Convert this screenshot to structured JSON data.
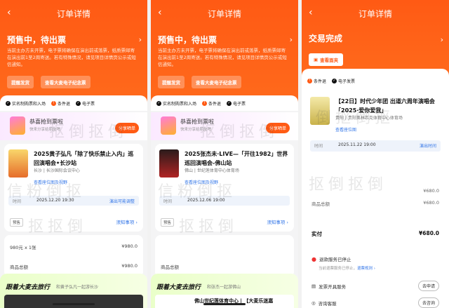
{
  "nav": {
    "title": "订单详情",
    "back": "‹"
  },
  "colors": {
    "brand": "#ff5a14",
    "link": "#3477e8"
  },
  "panel1": {
    "status": "预售中，待出票",
    "notice": "当前主办方未开票，电子票将确保在演出前或落票，纸质票邮寄在演出前1至2周寄送。若有特殊情况，请见项目详情页公示或短信通知。",
    "btn_remind": "提醒发货",
    "btn_ticket": "查看大麦电子纪念票",
    "tags": [
      "实名制购票和入场",
      "条件退",
      "电子票"
    ],
    "promo_title": "恭喜抢到票啦",
    "promo_sub": "快来分享给朋友吧",
    "promo_btn": "分享晒单",
    "show_title": "2025黄子弘凡「除了快乐禁止入内」巡回演唱会•长沙站",
    "venue": "长沙 | 长沙国际会议中心",
    "map_link": "查看座位图及视野",
    "time_label": "时间",
    "time_value": "2025.12.20 19:30",
    "time_right": "演出可能调整",
    "presale": "预售",
    "notes": "须知事项 ›",
    "price_line": "980元 x 1张",
    "price_amount": "¥980.0",
    "total_label": "商品总额",
    "total_amount": "¥980.0",
    "banner_title": "跟着大麦去旅行",
    "banner_sub": "和黄子弘凡一起游长沙"
  },
  "panel2": {
    "status": "预售中，待出票",
    "notice": "当前主办方未开票，电子票将确保在演出前或落票，纸质票邮寄在演出前1至2周寄送。若有特殊情况，请见项目详情页公示或短信通知。",
    "btn_remind": "提醒发货",
    "btn_ticket": "查看大麦电子纪念票",
    "tags": [
      "实名制购票和入场",
      "条件退",
      "电子票"
    ],
    "promo_title": "恭喜抢到票啦",
    "promo_sub": "快来分享给朋友吧",
    "promo_btn": "分享晒单",
    "show_title": "2025张杰未·LIVE—「开往1982」世界巡回演唱会-佛山站",
    "venue": "佛山 | 世纪莲体育中心体育场",
    "map_link": "查看座位图及视野",
    "time_label": "时间",
    "time_value": "2025.12.06 19:00",
    "presale": "预售",
    "notes": "须知事项 ›",
    "total_label": "商品总额",
    "banner_title": "跟着大麦去旅行",
    "banner_sub": "和张杰一起游佛山",
    "banner_strip": "佛山世纪莲体育中心 | 【大麦乐迷嘉"
  },
  "panel3": {
    "status": "交易完成",
    "btn_view": "查看面夹",
    "tags": [
      "条件退",
      "电子发票"
    ],
    "show_title": "【22日】时代少年团 出道六周年演唱会「2025·爱你爱我」",
    "venue": "贵阳 | 贵阳奥林匹克体育中心体育场",
    "map_link": "查看座位图",
    "time_label": "时间",
    "time_value": "2025.11.22 19:00",
    "time_right": "演出时间",
    "amount1": "¥680.0",
    "amount2": "¥680.0",
    "total_label": "商品总额",
    "paid_label": "实付",
    "paid_amount": "¥680.0",
    "refund_title": "退款服务已停止",
    "refund_sub": "当前退票服务已停止，",
    "refund_link": "退票规则 ›",
    "invoice": "发票开具服务",
    "invoice_btn": "去申请",
    "consult": "咨询客服",
    "consult_btn": "去咨询"
  }
}
